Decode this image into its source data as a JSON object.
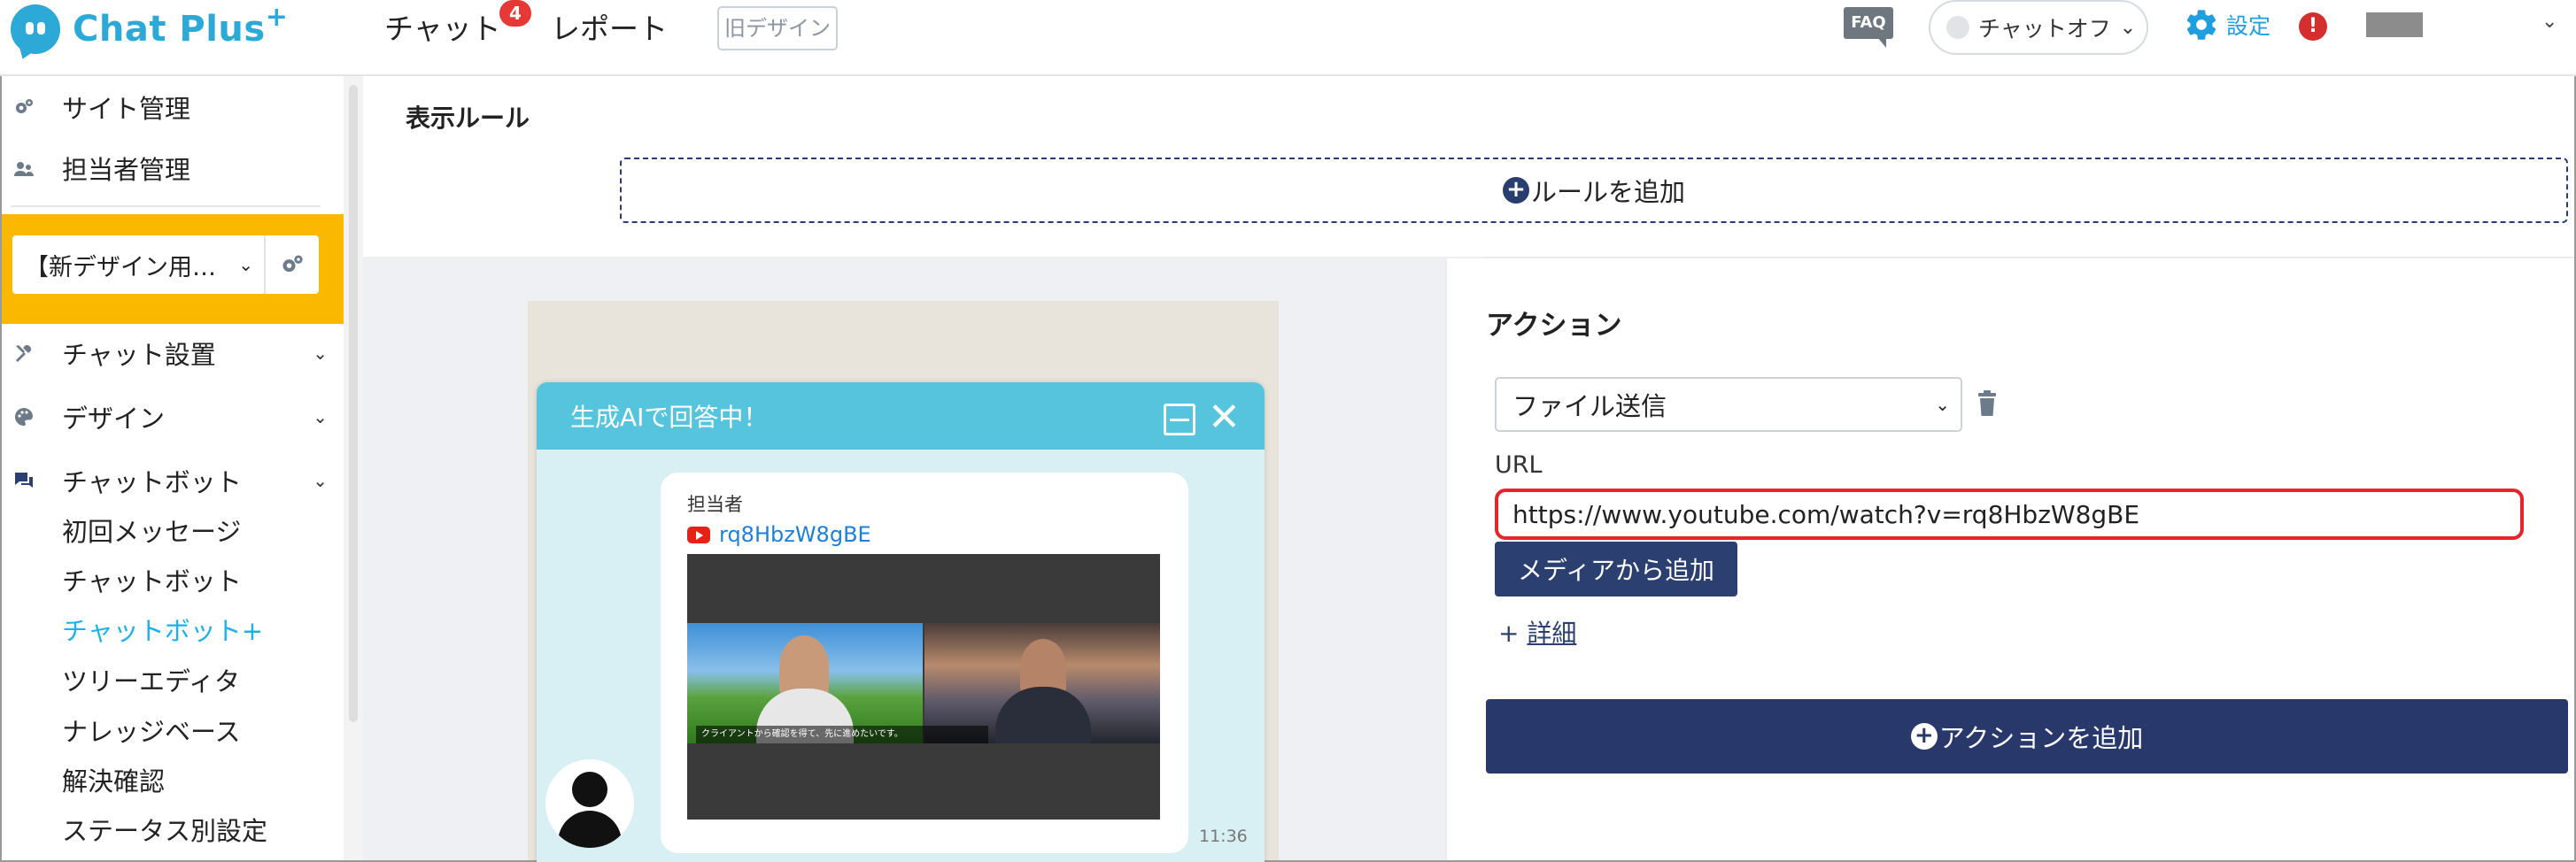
{
  "topbar": {
    "logo_text": "Chat Plus",
    "logo_plus": "+",
    "nav_chat": "チャット",
    "chat_badge": "4",
    "nav_report": "レポート",
    "old_design": "旧デザイン",
    "faq": "FAQ",
    "chat_status": "チャットオフ",
    "settings": "設定",
    "alert": "!"
  },
  "sidebar": {
    "site_management": "サイト管理",
    "staff_management": "担当者管理",
    "site_select": "【新デザイン用…",
    "chat_settings": "チャット設置",
    "design": "デザイン",
    "chatbot": "チャットボット",
    "sub_items": [
      {
        "label": "初回メッセージ",
        "active": false
      },
      {
        "label": "チャットボット",
        "active": false
      },
      {
        "label": "チャットボット+",
        "active": true
      },
      {
        "label": "ツリーエディタ",
        "active": false
      },
      {
        "label": "ナレッジベース",
        "active": false
      },
      {
        "label": "解決確認",
        "active": false
      },
      {
        "label": "ステータス別設定",
        "active": false
      }
    ]
  },
  "rule": {
    "title": "表示ルール",
    "add_rule": "ルールを追加"
  },
  "preview": {
    "header": "生成AIで回答中！",
    "sender": "担当者",
    "video_id": "rq8HbzW8gBE",
    "caption": "クライアントから確認を得て、先に進めたいです。",
    "time": "11:36"
  },
  "action": {
    "title": "アクション",
    "type_value": "ファイル送信",
    "url_label": "URL",
    "url_value": "https://www.youtube.com/watch?v=rq8HbzW8gBE",
    "media_button": "メディアから追加",
    "detail_plus": "+",
    "detail_link": "詳細",
    "add_action": "アクションを追加"
  },
  "colors": {
    "brand": "#2ca9d6",
    "navy": "#28386b",
    "highlight": "#fbb800",
    "url_border": "#e8232a",
    "active_item": "#1fb0e6"
  }
}
